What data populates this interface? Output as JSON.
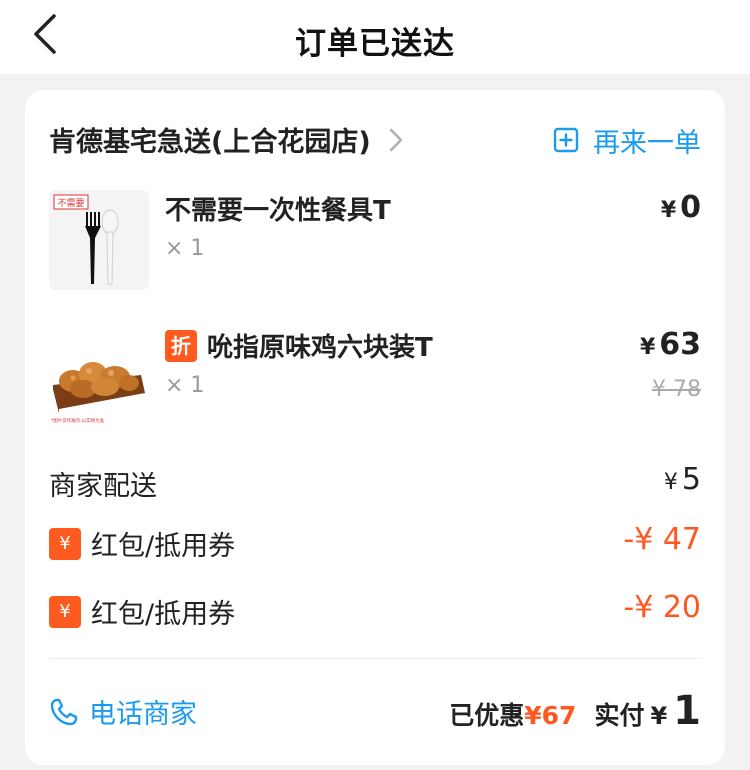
{
  "header": {
    "title": "订单已送达"
  },
  "shop": {
    "name": "肯德基宅急送(上合花园店)",
    "reorder_label": "再来一单"
  },
  "items": [
    {
      "name": "不需要一次性餐具T",
      "qty": "× 1",
      "currency": "¥",
      "price": "0",
      "thumb_tag": "不需要"
    },
    {
      "badge": "折",
      "name": "吮指原味鸡六块装T",
      "qty": "× 1",
      "currency": "¥",
      "price": "63",
      "original_price": "¥ 78",
      "thumb_caption": "*图片仅作展示,以实物为准"
    }
  ],
  "fees": {
    "delivery": {
      "label": "商家配送",
      "currency": "¥",
      "value": "5"
    },
    "coupons": [
      {
        "icon": "¥",
        "label": "红包/抵用券",
        "value": "-¥ 47"
      },
      {
        "icon": "¥",
        "label": "红包/抵用券",
        "value": "-¥ 20"
      }
    ]
  },
  "footer": {
    "call_label": "电话商家",
    "saved_label": "已优惠",
    "saved_amount": "¥67",
    "paid_label": "实付",
    "paid_currency": "¥",
    "paid_amount": "1"
  },
  "colors": {
    "accent": "#1b9bf0",
    "discount": "#ff5722",
    "badge": "#ff5a1f"
  }
}
